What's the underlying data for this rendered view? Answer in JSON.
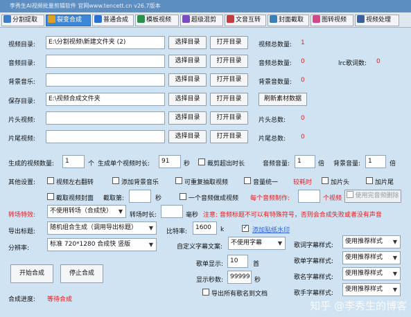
{
  "window": {
    "title": "李秀生AI视频批量剪辑软件    官网www.tencett.cn    v26.7版本"
  },
  "tabs": [
    {
      "label": "分割提取",
      "icon": "film-icon",
      "color": "#3d7cc9"
    },
    {
      "label": "裂变合成",
      "icon": "merge-icon",
      "color": "#e0a020"
    },
    {
      "label": "普通合成",
      "icon": "play-icon",
      "color": "#2b6fd0"
    },
    {
      "label": "模板视频",
      "icon": "template-icon",
      "color": "#2a8f4a"
    },
    {
      "label": "超级混剪",
      "icon": "mix-icon",
      "color": "#7a4bc4"
    },
    {
      "label": "文音互转",
      "icon": "mic-icon",
      "color": "#c23e3e"
    },
    {
      "label": "封面截取",
      "icon": "crop-icon",
      "color": "#3b7fb8"
    },
    {
      "label": "图转视频",
      "icon": "image-icon",
      "color": "#d04a8a"
    },
    {
      "label": "视频处理",
      "icon": "video-icon",
      "color": "#3b5fa0"
    }
  ],
  "rows": {
    "video_dir": {
      "label": "视频目录:",
      "value": "E:\\分割视频\\新建文件夹 (2)",
      "count_label": "视频总数量:",
      "count": "1"
    },
    "audio_dir": {
      "label": "音频目录:",
      "value": "",
      "count_label": "音频总数量:",
      "count": "0",
      "lrc_label": "lrc歌词数:",
      "lrc_count": "0"
    },
    "bgm": {
      "label": "背景音乐:",
      "value": "",
      "count_label": "背景音数量:",
      "count": "0"
    },
    "save_dir": {
      "label": "保存目录:",
      "value": "E:\\视频合成文件夹",
      "refresh": "刷新素材数据"
    },
    "head_video": {
      "label": "片头视频:",
      "value": "",
      "count_label": "片头总数:",
      "count": "0"
    },
    "tail_video": {
      "label": "片尾视频:",
      "value": "",
      "count_label": "片尾总数:",
      "count": "0"
    }
  },
  "buttons": {
    "select_dir": "选择目录",
    "open_dir": "打开目录"
  },
  "settings": {
    "gen_count_label": "生成的视频数量:",
    "gen_count": "1",
    "unit_ge": "个",
    "single_len_label": "生成单个视频时长:",
    "single_len": "91",
    "unit_sec": "秒",
    "crop_over": "裁剪超出时长",
    "video_vol_label": "音频音量:",
    "video_vol": "1",
    "unit_bei": "倍",
    "bg_vol_label": "背景音量:",
    "bg_vol": "1",
    "other_label": "其他设置:",
    "flip": "视频左右翻转",
    "add_bgm": "添加背景音乐",
    "repeat_extract": "可重复抽取视频",
    "vol_unify": "音量统一",
    "slow_note": "较耗时",
    "add_head": "加片头",
    "add_tail": "加片尾",
    "crop_cover": "截取视频封面",
    "crop_frames_label": "截取第:",
    "crop_frames": "",
    "unit_sec2": "秒",
    "one_audio": "一个音频做成视频",
    "per_audio_make": "每个音频制作:",
    "per_audio_count": "",
    "per_audio_unit": "个视频",
    "use_audio_delete": "使用完音频删除",
    "transition_label": "转场特效:",
    "transition_value": "不使用转场（合成快）",
    "transition_len_label": "转场时长:",
    "transition_len": "",
    "unit_ms": "毫秒",
    "note": "注意: 音频标题不可以有特殊符号，否则会合成失败或者没有声音",
    "export_title_label": "导出标题:",
    "export_title_value": "随机组合生成（调用导出标题）",
    "bitrate_label": "比特率:",
    "bitrate": "1600",
    "bitrate_unit": "k",
    "add_watermark": "添加贴纸水印",
    "resolution_label": "分辨率:",
    "resolution_value": "标准 720*1280 合成快 竖版",
    "custom_subtitle_label": "自定义字幕文案:",
    "custom_subtitle_value": "不使用字幕",
    "lyric_show_label": "歌单显示:",
    "lyric_show": "10",
    "lyric_show_unit": "首",
    "show_sec_label": "显示秒数:",
    "show_sec": "99999",
    "show_sec_unit": "秒",
    "export_all_names": "导出所有歌名到文档",
    "lyric_style_label": "歌词字幕样式:",
    "song_list_style_label": "歌单字幕样式:",
    "song_name_style_label": "歌名字幕样式:",
    "singer_style_label": "歌手字幕样式:",
    "style_value": "使用推荐样式"
  },
  "actions": {
    "start": "开始合成",
    "stop": "停止合成"
  },
  "status": {
    "label": "合成进度:",
    "value": "等待合成"
  },
  "watermark": "知乎 @李秀生的博客"
}
